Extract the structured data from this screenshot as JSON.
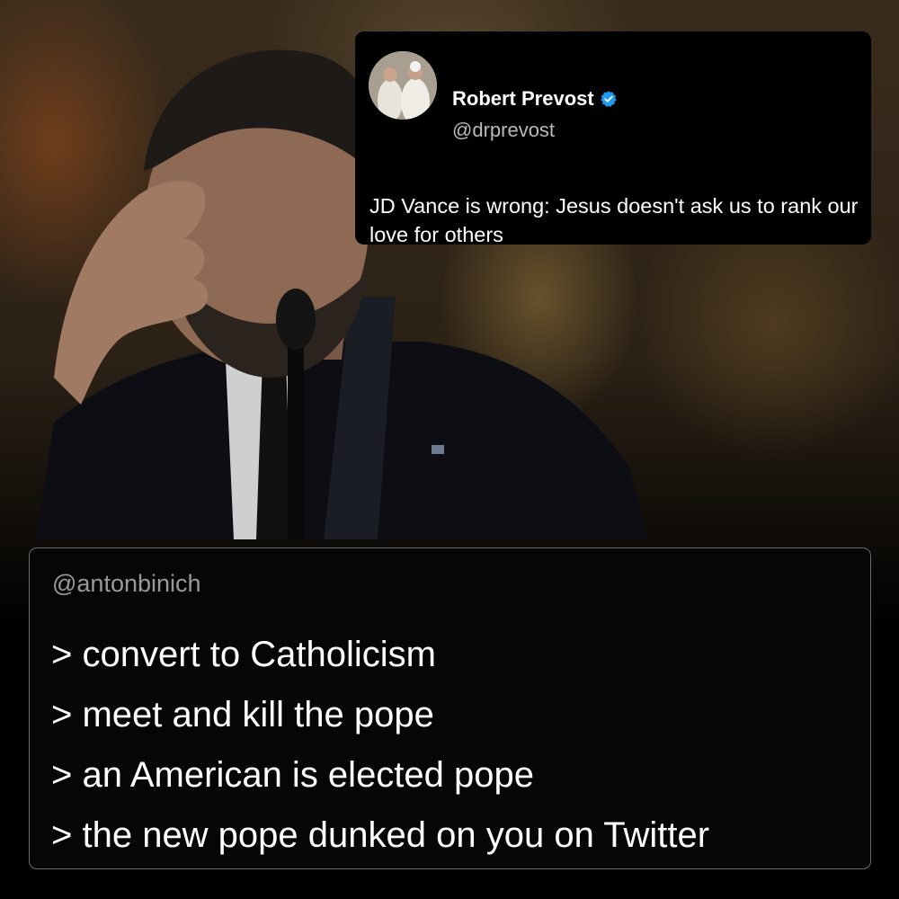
{
  "tweet": {
    "name": "Robert Prevost",
    "handle": "@drprevost",
    "text": "JD Vance is wrong: Jesus doesn't ask us to rank our love for others",
    "verified_color": "#1d9bf0"
  },
  "greentext": {
    "handle": "@antonbinich",
    "lines": [
      "> convert to Catholicism",
      "> meet and kill the pope",
      "> an American is elected pope",
      "> the new pope dunked on you on Twitter"
    ]
  },
  "background": {
    "subject": "man in dark suit with hand on forehead at microphone"
  }
}
